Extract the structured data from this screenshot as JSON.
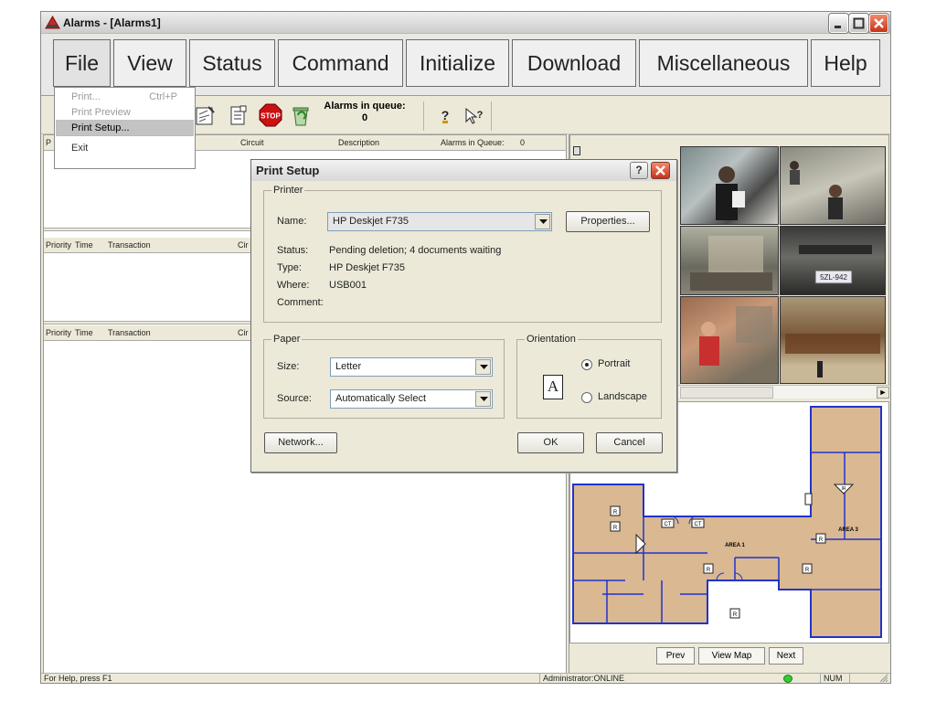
{
  "window": {
    "title": "Alarms - [Alarms1]"
  },
  "menubar": {
    "items": [
      "File",
      "View",
      "Status",
      "Command",
      "Initialize",
      "Download",
      "Miscellaneous",
      "Help"
    ]
  },
  "file_menu": {
    "items": [
      {
        "label": "Print...",
        "shortcut": "Ctrl+P",
        "enabled": false
      },
      {
        "label": "Print Preview",
        "enabled": false
      },
      {
        "label": "Print Setup...",
        "enabled": true,
        "highlighted": true
      },
      {
        "label": "Exit",
        "enabled": true
      }
    ]
  },
  "toolbar": {
    "icons": [
      "clipboard-icon",
      "document-list-icon",
      "stop-icon",
      "recycle-icon",
      "help-icon",
      "context-help-icon"
    ],
    "stop_text": "STOP",
    "queue_label": "Alarms in queue:",
    "queue_count": "0"
  },
  "panes": {
    "top_header": {
      "p": "P",
      "circuit": "Circuit",
      "description": "Description",
      "alarms_in_queue": "Alarms in Queue:",
      "queue_value": "0"
    },
    "mid_header": {
      "priority": "Priority",
      "time": "Time",
      "transaction": "Transaction",
      "circuit": "Cir"
    },
    "bottom_header": {
      "priority": "Priority",
      "time": "Time",
      "transaction": "Transaction",
      "circuit": "Cir"
    }
  },
  "dialog": {
    "title": "Print Setup",
    "help_glyph": "?",
    "printer": {
      "group_label": "Printer",
      "name_label": "Name:",
      "name_value": "HP Deskjet F735",
      "properties_button": "Properties...",
      "status_label": "Status:",
      "status_value": "Pending deletion; 4 documents waiting",
      "type_label": "Type:",
      "type_value": "HP Deskjet F735",
      "where_label": "Where:",
      "where_value": "USB001",
      "comment_label": "Comment:",
      "comment_value": ""
    },
    "paper": {
      "group_label": "Paper",
      "size_label": "Size:",
      "size_value": "Letter",
      "source_label": "Source:",
      "source_value": "Automatically Select"
    },
    "orientation": {
      "group_label": "Orientation",
      "page_glyph": "A",
      "portrait_label": "Portrait",
      "landscape_label": "Landscape",
      "selected": "Portrait"
    },
    "network_button": "Network...",
    "ok_button": "OK",
    "cancel_button": "Cancel"
  },
  "map": {
    "area1_label": "AREA 1",
    "area3_label": "AREA 3",
    "ir_label": "IR",
    "r_label": "R",
    "ct_label": "CT",
    "license_plate": "5ZL-942"
  },
  "map_nav": {
    "prev": "Prev",
    "view_map": "View Map",
    "next": "Next"
  },
  "statusbar": {
    "help_text": "For Help, press F1",
    "user_status": "Administrator:ONLINE",
    "num": "NUM"
  },
  "colors": {
    "title_close": "#D9502E",
    "menu_highlight": "#C3C3C3",
    "map_wall": "#2233CC",
    "map_floor": "#D9B892",
    "status_indicator": "#33CC33"
  }
}
